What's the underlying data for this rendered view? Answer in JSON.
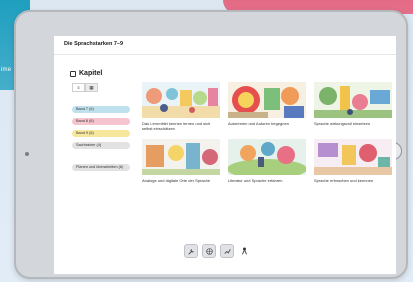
{
  "background": {
    "edge_text": "ime"
  },
  "app": {
    "title": "Die Sprachstarken 7–9"
  },
  "sidebar": {
    "heading": "Kapitel",
    "view_toggle": [
      "≡",
      "▦"
    ],
    "chips": [
      {
        "label": "Band 7 (6)",
        "color": "#bfe1ee"
      },
      {
        "label": "Band 8 (6)",
        "color": "#f5c4cf"
      },
      {
        "label": "Band 9 (6)",
        "color": "#f7e79c"
      },
      {
        "label": "Sachtrainer (4)",
        "color": "#e2e2e2"
      }
    ],
    "standalone_chip": "Planen und überarbeiten (6)"
  },
  "chapters": [
    {
      "label": "Das Lernmittel kennen lernen und sich selbst einschätzen"
    },
    {
      "label": "Autorinnen und Autoren begegnen"
    },
    {
      "label": "Sprache wirkungsvoll einsetzen"
    },
    {
      "label": "Analoge und digitale Orte der Sprache"
    },
    {
      "label": "Literatur und Sprache erfahren"
    },
    {
      "label": "Sprache erforschen und kennnen"
    }
  ],
  "toolbar": {
    "items": [
      "wrench-icon",
      "globe-icon",
      "chart-icon",
      "user-icon"
    ]
  },
  "colors": {
    "accent_teal": "#1f9fbf",
    "accent_pink": "#e46b86"
  }
}
